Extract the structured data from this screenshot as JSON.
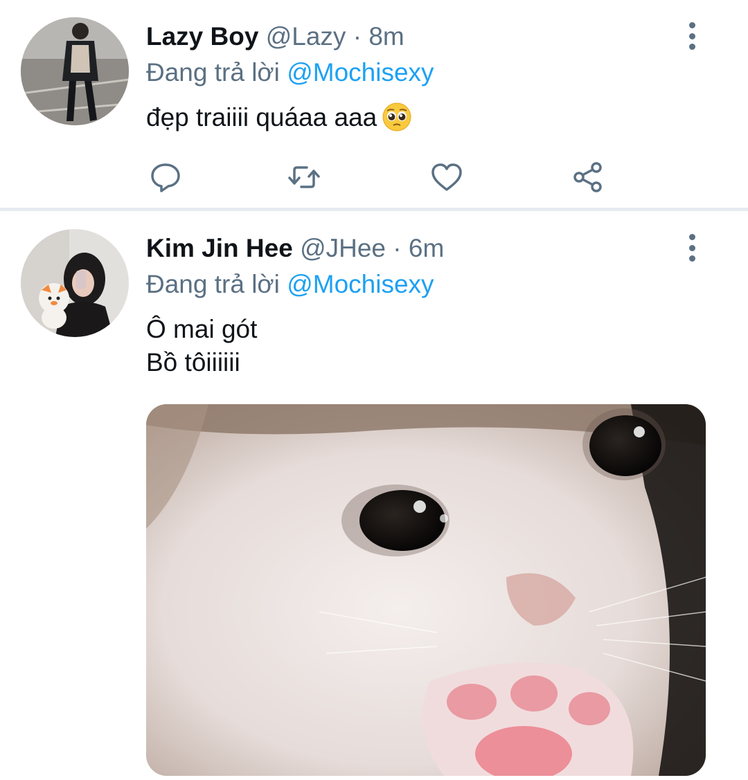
{
  "tweets": [
    {
      "name": "Lazy Boy",
      "handle": "@Lazy",
      "separator": "·",
      "time": "8m",
      "reply_prefix": "Đang trả lời",
      "reply_to": "@Mochisexy",
      "text_lines": [
        "đẹp traiiii quáaa aaa"
      ],
      "emoji": "pleading-face-emoji",
      "avatar": "avatar-man-walking",
      "actions": [
        "reply-icon",
        "retweet-icon",
        "like-icon",
        "share-icon"
      ]
    },
    {
      "name": "Kim Jin Hee",
      "handle": "@JHee",
      "separator": "·",
      "time": "6m",
      "reply_prefix": "Đang trả lời",
      "reply_to": "@Mochisexy",
      "text_lines": [
        "Ô mai gót",
        "Bồ tôiiiiii"
      ],
      "avatar": "avatar-girl-with-plush",
      "media": "crying-cat-photo"
    }
  ],
  "colors": {
    "text": "#0f1419",
    "secondary": "#5b7083",
    "accent": "#1da1f2",
    "divider": "#e6ecf0"
  }
}
